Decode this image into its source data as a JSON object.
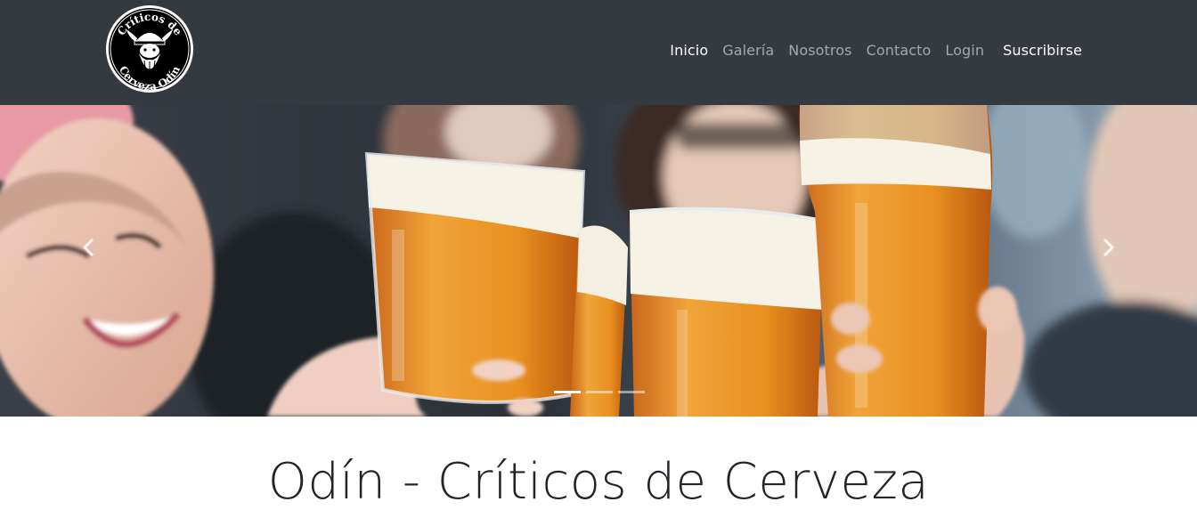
{
  "navbar": {
    "logo": {
      "text_top": "Críticos de",
      "text_bottom": "Cerveza Odín"
    },
    "links": [
      {
        "label": "Inicio",
        "active": true
      },
      {
        "label": "Galería",
        "active": false
      },
      {
        "label": "Nosotros",
        "active": false
      },
      {
        "label": "Contacto",
        "active": false
      },
      {
        "label": "Login",
        "active": false
      }
    ],
    "cta_label": "Suscribirse"
  },
  "carousel": {
    "slide_count": 3,
    "active_index": 0,
    "prev_icon": "chevron-left-icon",
    "next_icon": "chevron-right-icon"
  },
  "main": {
    "title": "Odín - Críticos de Cerveza"
  },
  "colors": {
    "navbar_bg": "#343a40",
    "beer": "#e08a22",
    "foam": "#f7f2e6"
  }
}
